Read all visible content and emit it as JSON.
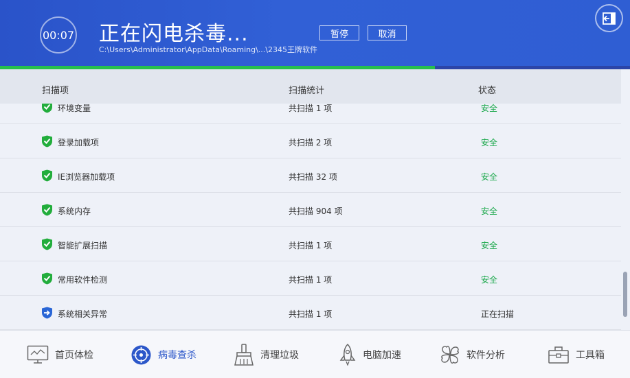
{
  "header": {
    "timer": "00:07",
    "title": "正在闪电杀毒...",
    "path": "C:\\Users\\Administrator\\AppData\\Roaming\\...\\2345王牌软件",
    "pause_label": "暂停",
    "cancel_label": "取消",
    "progress_percent": 69
  },
  "table": {
    "col_item": "扫描项",
    "col_stats": "扫描统计",
    "col_status": "状态",
    "rows": [
      {
        "name": "环境变量",
        "stats": "共扫描 1 项",
        "status": "安全",
        "state": "safe"
      },
      {
        "name": "登录加载项",
        "stats": "共扫描 2 项",
        "status": "安全",
        "state": "safe"
      },
      {
        "name": "IE浏览器加载项",
        "stats": "共扫描 32 项",
        "status": "安全",
        "state": "safe"
      },
      {
        "name": "系统内存",
        "stats": "共扫描 904 项",
        "status": "安全",
        "state": "safe"
      },
      {
        "name": "智能扩展扫描",
        "stats": "共扫描 1 项",
        "status": "安全",
        "state": "safe"
      },
      {
        "name": "常用软件检测",
        "stats": "共扫描 1 项",
        "status": "安全",
        "state": "safe"
      },
      {
        "name": "系统相关异常",
        "stats": "共扫描 1 项",
        "status": "正在扫描",
        "state": "scanning"
      }
    ]
  },
  "nav": {
    "items": [
      {
        "label": "首页体检",
        "icon": "monitor-icon"
      },
      {
        "label": "病毒查杀",
        "icon": "target-icon",
        "active": true
      },
      {
        "label": "清理垃圾",
        "icon": "broom-icon"
      },
      {
        "label": "电脑加速",
        "icon": "rocket-icon"
      },
      {
        "label": "软件分析",
        "icon": "clover-icon"
      },
      {
        "label": "工具箱",
        "icon": "toolbox-icon"
      }
    ]
  },
  "colors": {
    "header_blue": "#2f5ed3",
    "progress_green": "#27c04c",
    "safe_green": "#1aa84a",
    "active_blue": "#2c57c9"
  }
}
